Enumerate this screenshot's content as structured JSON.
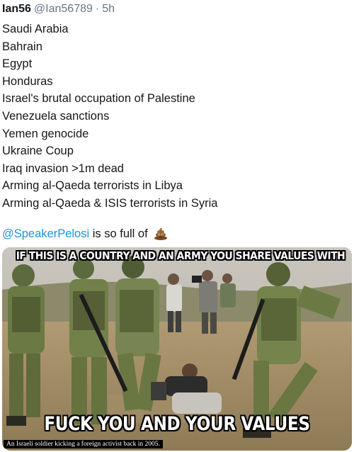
{
  "tweet": {
    "display_name": "Ian56",
    "handle": "@Ian56789",
    "separator": "·",
    "time": "5h",
    "lines": [
      "Saudi Arabia",
      "Bahrain",
      "Egypt",
      "Honduras",
      "Israel's brutal occupation of Palestine",
      "Venezuela sanctions",
      "Yemen genocide",
      "Ukraine Coup",
      "Iraq invasion >1m dead",
      "Arming al-Qaeda terrorists in Libya",
      "Arming al-Qaeda & ISIS terrorists in Syria"
    ],
    "mention": "@SpeakerPelosi",
    "mention_suffix": "is so full of",
    "emoji_icon": "poop-emoji"
  },
  "image": {
    "top_text": "IF THIS IS A COUNTRY AND AN ARMY YOU SHARE VALUES WITH",
    "bottom_text": "FUCK YOU AND YOUR VALUES",
    "caption": "An Israeli soldier kicking a foreign activist back in 2005."
  },
  "colors": {
    "text": "#14171a",
    "muted": "#657786",
    "link": "#1b95e0"
  }
}
